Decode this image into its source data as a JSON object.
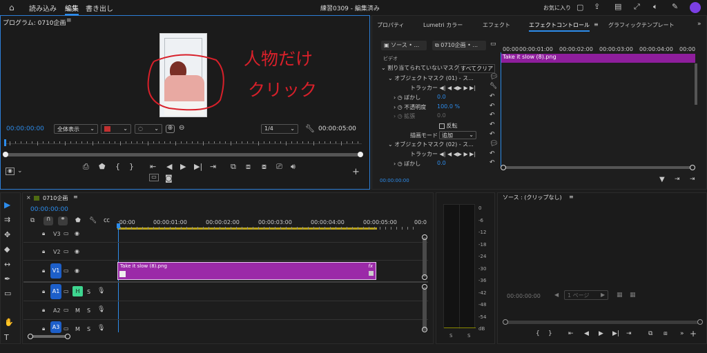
{
  "menubar": {
    "items": [
      "読み込み",
      "編集",
      "書き出し"
    ],
    "active": "編集",
    "project_title": "練習0309 - 編集済み",
    "favorites_label": "お気に入り"
  },
  "program_monitor": {
    "title": "プログラム: 0710企画",
    "menu_glyph": "≡",
    "timecode_left": "00:00:00:00",
    "fit_label": "全体表示",
    "quality_label": "1/4",
    "timecode_right": "00:00:05:00",
    "annotation_line1": "人物だけ",
    "annotation_line2": "クリック"
  },
  "effect_panel": {
    "tabs": [
      "プロパティ",
      "Lumetri カラー",
      "エフェクト",
      "エフェクトコントロール",
      "グラフィックテンプレート"
    ],
    "active_tab": "エフェクトコントロール",
    "source_label": "ソース • ...",
    "sequence_label": "0710企画 • ...",
    "section_video": "ビデオ",
    "group_label": "割り当てられていないマスク",
    "clear_all": "すべてクリア",
    "mask1_label": "オブジェクトマスク (01) - ス...",
    "tracker_label": "トラッカー",
    "blur_label": "ぼかし",
    "blur_value": "0.0",
    "opacity_label": "不透明度",
    "opacity_value": "100.0 %",
    "expand_label": "拡張",
    "expand_value": "0.0",
    "invert_label": "反転",
    "blend_label": "描画モード",
    "blend_value": "追加",
    "mask2_label": "オブジェクトマスク (02) - ス...",
    "tracker2_label": "トラッカー",
    "blur2_label": "ぼかし",
    "blur2_value": "0.0",
    "clip_name": "Take it slow (8).png",
    "footer_time": "00:00:00:00",
    "ruler_labels": [
      "00:00",
      "00:00:01:00",
      "00:00:02:00",
      "00:00:03:00",
      "00:00:04:00",
      "00:00"
    ]
  },
  "timeline": {
    "sequence_tab": "0710企画",
    "timecode": "00:00:00:00",
    "ruler_labels": [
      ":00:00",
      "00:00:01:00",
      "00:00:02:00",
      "00:00:03:00",
      "00:00:04:00",
      "00:00:05:00",
      "00:0"
    ],
    "tracks": [
      {
        "name": "V3"
      },
      {
        "name": "V2"
      },
      {
        "name": "V1"
      },
      {
        "name": "A1"
      },
      {
        "name": "A2"
      },
      {
        "name": "A3"
      }
    ],
    "clip_name": "Take it slow (8).png",
    "fx_label": "fx",
    "m_label": "M",
    "s_label": "S",
    "h_label": "H"
  },
  "audio_meter": {
    "labels": [
      "0",
      "-6",
      "-12",
      "-18",
      "-24",
      "-30",
      "-36",
      "-42",
      "-48",
      "-54",
      "dB"
    ],
    "solo_labels": [
      "S",
      "S"
    ]
  },
  "source_monitor": {
    "title": "ソース : (クリップなし)",
    "timecode": "00:00:00:00",
    "page_label": "1 ページ"
  },
  "colors": {
    "accent": "#2d8ceb",
    "clip_purple": "#9b2aa8",
    "annotation_red": "#d8202a"
  }
}
